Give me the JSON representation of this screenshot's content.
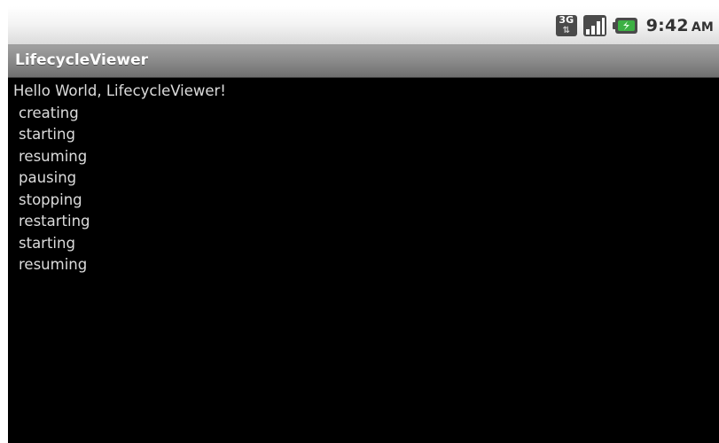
{
  "status_bar": {
    "network_type": "3G",
    "time": "9:42",
    "ampm": "AM",
    "icons": [
      "3g-data-icon",
      "signal-strength-icon",
      "battery-icon"
    ]
  },
  "title_bar": {
    "title": "LifecycleViewer"
  },
  "content": {
    "greeting": "Hello World, LifecycleViewer!",
    "log": [
      "creating",
      "starting",
      "resuming",
      "pausing",
      "stopping",
      "restarting",
      "starting",
      "resuming"
    ]
  },
  "colors": {
    "background": "#000000",
    "text": "#dcdcdc",
    "title_bar": "#8a8a8a",
    "battery_green": "#3cb043"
  }
}
